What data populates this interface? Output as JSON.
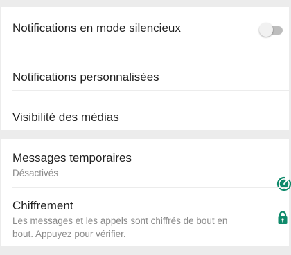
{
  "colors": {
    "accent": "#0f8a6b",
    "toggle_off_track": "#bdbdbd",
    "toggle_off_thumb": "#f1f1f1",
    "background": "#ececec",
    "surface": "#ffffff"
  },
  "group1": {
    "items": [
      {
        "label": "Notifications en mode silencieux",
        "toggle_on": false
      },
      {
        "label": "Notifications personnalisées"
      },
      {
        "label": "Visibilité des médias"
      }
    ]
  },
  "group2": {
    "items": [
      {
        "label": "Messages temporaires",
        "sublabel": "Désactivés",
        "icon": "timer-icon"
      },
      {
        "label": "Chiffrement",
        "sublabel_line1": "Les messages et les appels sont chiffrés de bout en",
        "sublabel_line2": "bout. Appuyez pour vérifier.",
        "icon": "lock-icon"
      }
    ]
  }
}
